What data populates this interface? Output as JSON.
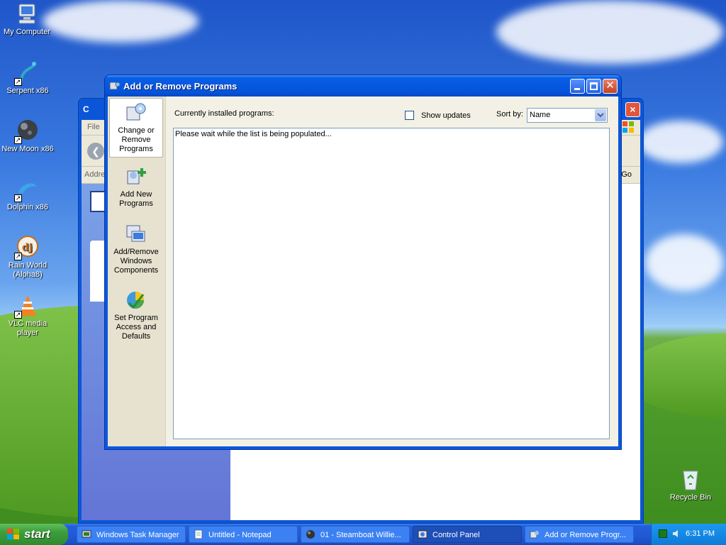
{
  "desktop": {
    "icons": [
      {
        "label": "My Computer",
        "icon": "computer-icon"
      },
      {
        "label": "Serpent x86",
        "icon": "serpent-icon"
      },
      {
        "label": "New Moon x86",
        "icon": "moon-icon"
      },
      {
        "label": "Dolphin x86",
        "icon": "dolphin-icon"
      },
      {
        "label": "Rain World (Alpha8)",
        "icon": "rain-world-icon"
      },
      {
        "label": "VLC media player",
        "icon": "vlc-icon"
      },
      {
        "label": "Recycle Bin",
        "icon": "recycle-bin-icon"
      }
    ]
  },
  "bg_window": {
    "title_frag": "C",
    "menu_frag": "File",
    "addr_frag": "Addre",
    "go_label": "Go"
  },
  "dialog": {
    "title": "Add or Remove Programs",
    "sidebar": [
      {
        "label": "Change or Remove Programs",
        "icon": "change-remove-programs-icon"
      },
      {
        "label": "Add New Programs",
        "icon": "add-programs-icon"
      },
      {
        "label": "Add/Remove Windows Components",
        "icon": "windows-components-icon"
      },
      {
        "label": "Set Program Access and Defaults",
        "icon": "program-defaults-icon"
      }
    ],
    "installed_label": "Currently installed programs:",
    "show_updates_label": "Show updates",
    "show_updates_checked": false,
    "sort_label": "Sort by:",
    "sort_value": "Name",
    "list_status": "Please wait while the list is being populated..."
  },
  "taskbar": {
    "start_label": "start",
    "items": [
      {
        "label": "Windows Task Manager",
        "icon": "task-manager-icon"
      },
      {
        "label": "Untitled - Notepad",
        "icon": "notepad-icon"
      },
      {
        "label": "01 - Steamboat Willie...",
        "icon": "media-icon"
      },
      {
        "label": "Control Panel",
        "icon": "control-panel-icon"
      },
      {
        "label": "Add or Remove Progr...",
        "icon": "add-remove-icon"
      }
    ],
    "clock": "6:31 PM"
  }
}
